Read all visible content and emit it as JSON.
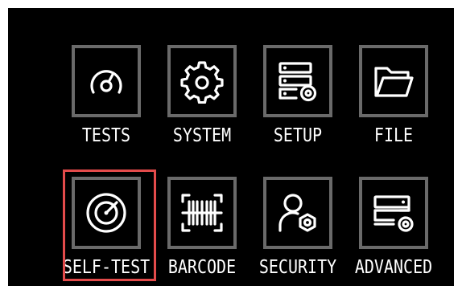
{
  "menu": {
    "row1": [
      {
        "label": "TESTS",
        "icon": "gauge-icon"
      },
      {
        "label": "SYSTEM",
        "icon": "gear-icon"
      },
      {
        "label": "SETUP",
        "icon": "server-settings-icon"
      },
      {
        "label": "FILE",
        "icon": "folder-icon"
      }
    ],
    "row2": [
      {
        "label": "SELF-TEST",
        "icon": "radar-icon",
        "selected": true
      },
      {
        "label": "BARCODE",
        "icon": "barcode-icon"
      },
      {
        "label": "SECURITY",
        "icon": "user-security-icon"
      },
      {
        "label": "ADVANCED",
        "icon": "advanced-settings-icon"
      }
    ]
  },
  "colors": {
    "background": "#000000",
    "tile_border": "#6a6a6a",
    "selection": "#e34b4b",
    "text": "#ffffff"
  }
}
